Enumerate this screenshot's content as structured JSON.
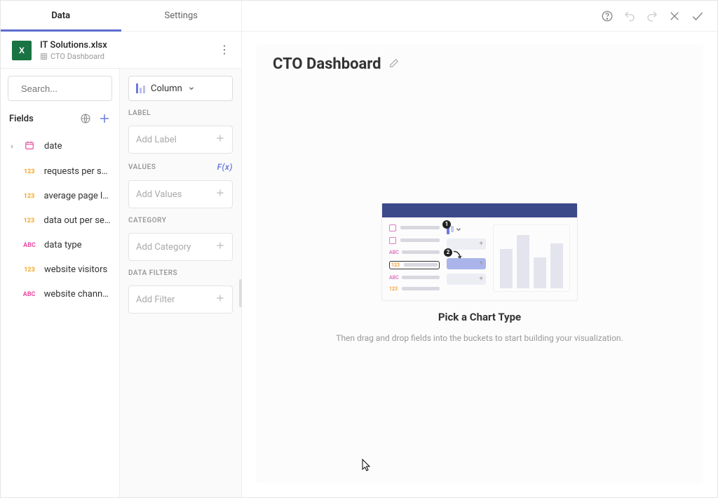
{
  "tabs": {
    "data": "Data",
    "settings": "Settings"
  },
  "file": {
    "name": "IT Solutions.xlsx",
    "sheet": "CTO Dashboard"
  },
  "search": {
    "placeholder": "Search..."
  },
  "fieldsHeader": "Fields",
  "fields": [
    {
      "type": "date",
      "label": "date"
    },
    {
      "type": "123",
      "label": "requests per se..."
    },
    {
      "type": "123",
      "label": "average page lo..."
    },
    {
      "type": "123",
      "label": "data out per sec..."
    },
    {
      "type": "ABC",
      "label": "data type"
    },
    {
      "type": "123",
      "label": "website visitors"
    },
    {
      "type": "ABC",
      "label": "website channels"
    }
  ],
  "chartTypeSelector": "Column",
  "buckets": {
    "labelHeading": "LABEL",
    "labelPlaceholder": "Add Label",
    "valuesHeading": "VALUES",
    "fx": "F(x)",
    "valuesPlaceholder": "Add Values",
    "categoryHeading": "CATEGORY",
    "categoryPlaceholder": "Add Category",
    "filtersHeading": "DATA FILTERS",
    "filtersPlaceholder": "Add Filter"
  },
  "dashboard": {
    "title": "CTO Dashboard",
    "emptyTitle": "Pick a Chart Type",
    "emptySubtitle": "Then drag and drop fields into the buckets to start building your visualization."
  }
}
